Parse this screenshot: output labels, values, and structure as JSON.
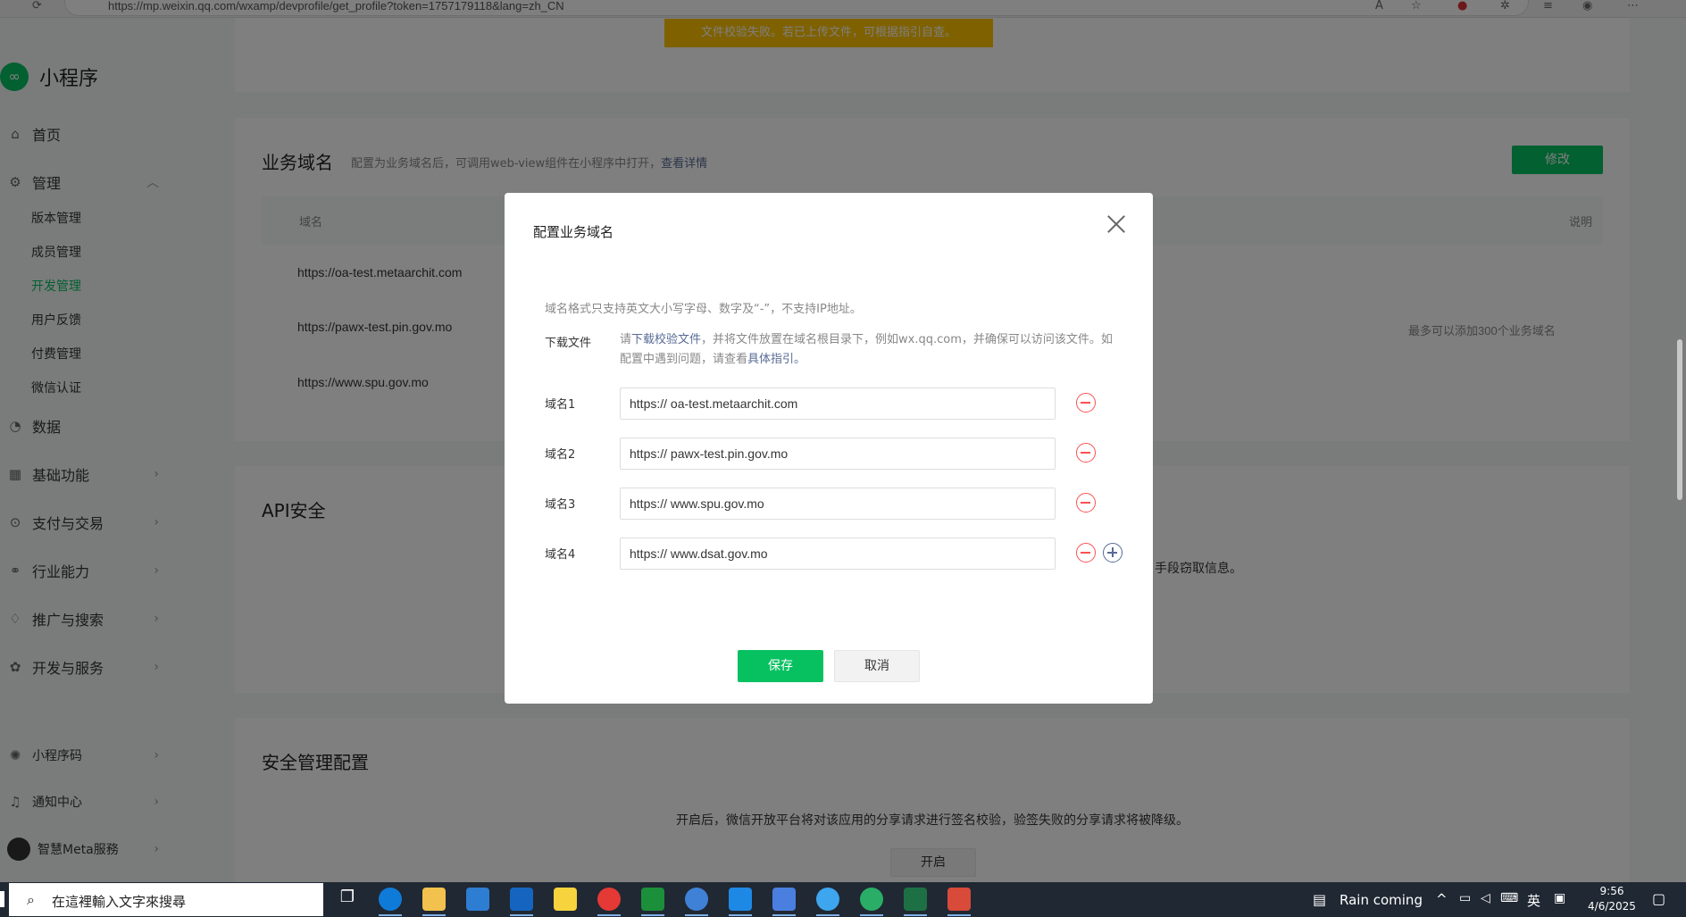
{
  "browser": {
    "url": "https://mp.weixin.qq.com/wxamp/devprofile/get_profile?token=1757179118&lang=zh_CN"
  },
  "toast": {
    "text": "文件校验失败。若已上传文件，可根据指引自查。",
    "color": "#ffc300"
  },
  "sidebar": {
    "logo": "小程序",
    "items": [
      {
        "label": "首页",
        "icon": "home-icon"
      },
      {
        "label": "管理",
        "icon": "settings-icon"
      },
      {
        "label": "数据",
        "icon": "chart-icon"
      },
      {
        "label": "基础功能",
        "icon": "grid-icon"
      },
      {
        "label": "支付与交易",
        "icon": "payment-icon"
      },
      {
        "label": "行业能力",
        "icon": "industry-icon"
      },
      {
        "label": "推广与搜索",
        "icon": "promote-icon"
      },
      {
        "label": "开发与服务",
        "icon": "dev-icon"
      },
      {
        "label": "小程序码",
        "icon": "qrcode-icon"
      },
      {
        "label": "通知中心",
        "icon": "bell-icon"
      },
      {
        "label": "智慧Meta服務",
        "icon": "avatar"
      }
    ],
    "sub_items": [
      "版本管理",
      "成员管理",
      "开发管理",
      "用户反馈",
      "付费管理",
      "微信认证"
    ],
    "active_sub": "开发管理"
  },
  "business_domain": {
    "title": "业务域名",
    "desc": "配置为业务域名后，可调用web-view组件在小程序中打开，",
    "desc_link": "查看详情",
    "modify_button": "修改",
    "col_domain": "域名",
    "col_note": "说明",
    "rows": [
      "https://oa-test.metaarchit.com",
      "https://pawx-test.pin.gov.mo",
      "https://www.spu.gov.mo"
    ],
    "limit_note": "最多可以添加300个业务域名"
  },
  "api_security": {
    "title": "API安全",
    "partial_text": "手段窃取信息。"
  },
  "security_config": {
    "title": "安全管理配置",
    "desc": "开启后，微信开放平台将对该应用的分享请求进行签名校验，验签失败的分享请求将被降级。",
    "button": "开启"
  },
  "dialog": {
    "title": "配置业务域名",
    "note": "域名格式只支持英文大小写字母、数字及“-”，不支持IP地址。",
    "download_label": "下载文件",
    "help_prefix": "请",
    "help_link1": "下载校验文件",
    "help_middle": "，并将文件放置在域名根目录下，例如wx.qq.com，并确保可以访问该文件。如配置中遇到问题，请查看",
    "help_link2": "具体指引。",
    "fields": [
      {
        "label": "域名1",
        "value": "https:// oa-test.metaarchit.com"
      },
      {
        "label": "域名2",
        "value": "https:// pawx-test.pin.gov.mo"
      },
      {
        "label": "域名3",
        "value": "https:// www.spu.gov.mo"
      },
      {
        "label": "域名4",
        "value": "https:// www.dsat.gov.mo"
      }
    ],
    "save_button": "保存",
    "cancel_button": "取消"
  },
  "taskbar": {
    "search_placeholder": "在這裡輸入文字來搜尋",
    "weather": "Rain coming",
    "ime": "英",
    "time": "9:56",
    "date": "4/6/2025"
  }
}
